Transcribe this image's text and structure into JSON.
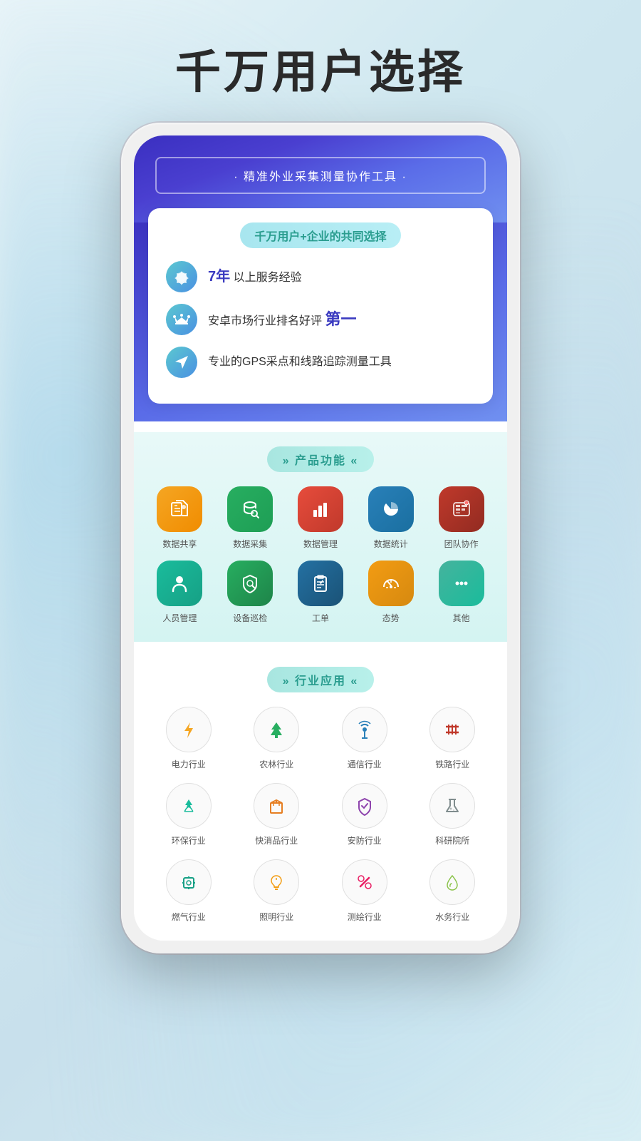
{
  "page": {
    "title": "千万用户选择",
    "bg_color": "#d8eef6"
  },
  "phone": {
    "banner_text": "· 精准外业采集测量协作工具 ·",
    "card": {
      "title": "千万用户+企业的共同选择",
      "features": [
        {
          "id": "years",
          "icon": "🌟",
          "text_before": "",
          "highlight": "7年",
          "text_after": " 以上服务经验"
        },
        {
          "id": "rank",
          "icon": "👑",
          "text_before": "安卓市场行业排名好评 ",
          "highlight": "第一",
          "text_after": ""
        },
        {
          "id": "gps",
          "icon": "📍",
          "text_before": "专业的GPS采点和线路追踪测量工具",
          "highlight": "",
          "text_after": ""
        }
      ]
    },
    "product_section": {
      "title": "» 产品功能 «",
      "items": [
        {
          "label": "数据共享",
          "icon": "share",
          "color": "bg-orange"
        },
        {
          "label": "数据采集",
          "icon": "database",
          "color": "bg-green"
        },
        {
          "label": "数据管理",
          "icon": "chart-bar",
          "color": "bg-red-orange"
        },
        {
          "label": "数据统计",
          "icon": "pie-chart",
          "color": "bg-blue"
        },
        {
          "label": "团队协作",
          "icon": "team",
          "color": "bg-dark-red"
        },
        {
          "label": "人员管理",
          "icon": "user",
          "color": "bg-teal"
        },
        {
          "label": "设备巡检",
          "icon": "shield-search",
          "color": "bg-teal-green"
        },
        {
          "label": "工单",
          "icon": "clipboard",
          "color": "bg-blue-dark"
        },
        {
          "label": "态势",
          "icon": "clock-chart",
          "color": "bg-yellow"
        },
        {
          "label": "其他",
          "icon": "more",
          "color": "bg-green-muted"
        }
      ]
    },
    "industry_section": {
      "title": "» 行业应用 «",
      "items": [
        {
          "label": "电力行业",
          "icon": "⚡",
          "color_class": "yellow"
        },
        {
          "label": "农林行业",
          "icon": "🌲",
          "color_class": "green"
        },
        {
          "label": "通信行业",
          "icon": "📡",
          "color_class": "blue"
        },
        {
          "label": "铁路行业",
          "icon": "🛤",
          "color_class": "red"
        },
        {
          "label": "环保行业",
          "icon": "♻",
          "color_class": "teal"
        },
        {
          "label": "快消品行业",
          "icon": "📦",
          "color_class": "orange"
        },
        {
          "label": "安防行业",
          "icon": "🛡",
          "color_class": "purple"
        },
        {
          "label": "科研院所",
          "icon": "🧪",
          "color_class": "grey"
        },
        {
          "label": "燃气行业",
          "icon": "⚙",
          "color_class": "cyan"
        },
        {
          "label": "照明行业",
          "icon": "💡",
          "color_class": "gold"
        },
        {
          "label": "测绘行业",
          "icon": "✂",
          "color_class": "pink"
        },
        {
          "label": "水务行业",
          "icon": "💧",
          "color_class": "lime"
        }
      ]
    }
  }
}
